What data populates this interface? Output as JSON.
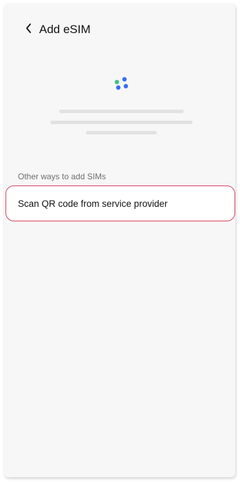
{
  "header": {
    "title": "Add eSIM",
    "back_icon": "chevron-left-icon"
  },
  "loading": {
    "icon": "loading-dots-icon",
    "colors": [
      "#3ec18a",
      "#3a6cf0",
      "#3a6cf0",
      "#3a6cf0"
    ]
  },
  "other_ways": {
    "section_label": "Other ways to add SIMs",
    "options": [
      {
        "label": "Scan QR code from service provider"
      }
    ]
  },
  "colors": {
    "background": "#f7f7f7",
    "card": "#ffffff",
    "highlight_border": "#d6455f",
    "skeleton": "#e2e2e2"
  }
}
